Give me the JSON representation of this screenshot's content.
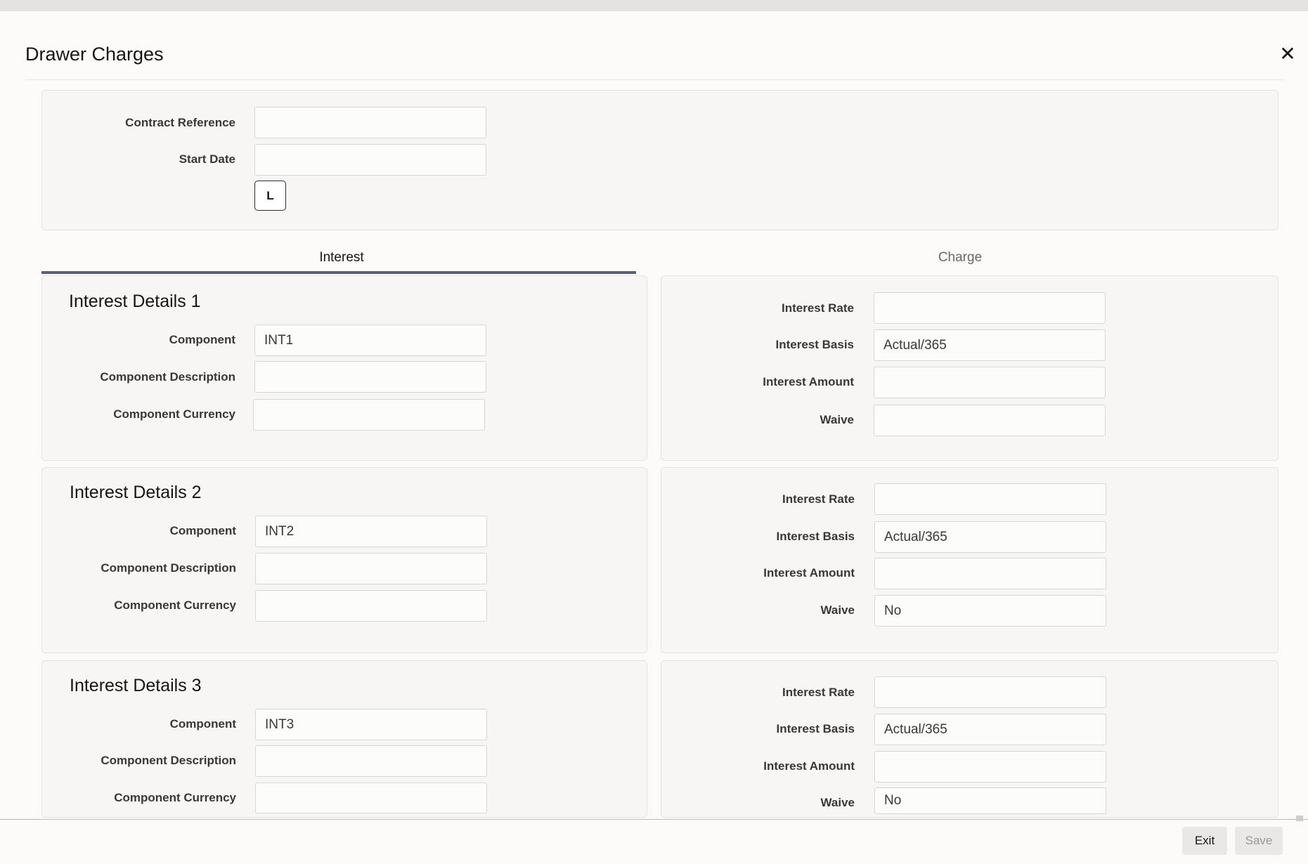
{
  "window": {
    "title": "Drawer Charges"
  },
  "header": {
    "contract_reference_label": "Contract Reference",
    "contract_reference_value": "",
    "start_date_label": "Start Date",
    "start_date_value": "",
    "lookup_button_label": "L"
  },
  "tabs": [
    {
      "label": "Interest",
      "active": true
    },
    {
      "label": "Charge",
      "active": false
    }
  ],
  "interest_details": [
    {
      "title": "Interest Details 1",
      "component_label": "Component",
      "component_value": "INT1",
      "description_label": "Component Description",
      "description_value": "",
      "currency_label": "Component Currency",
      "currency_value": "",
      "rate_label": "Interest Rate",
      "rate_value": "",
      "basis_label": "Interest Basis",
      "basis_value": "Actual/365",
      "amount_label": "Interest Amount",
      "amount_value": "",
      "waive_label": "Waive",
      "waive_value": ""
    },
    {
      "title": "Interest Details 2",
      "component_label": "Component",
      "component_value": "INT2",
      "description_label": "Component Description",
      "description_value": "",
      "currency_label": "Component Currency",
      "currency_value": "",
      "rate_label": "Interest Rate",
      "rate_value": "",
      "basis_label": "Interest Basis",
      "basis_value": "Actual/365",
      "amount_label": "Interest Amount",
      "amount_value": "",
      "waive_label": "Waive",
      "waive_value": "No"
    },
    {
      "title": "Interest Details 3",
      "component_label": "Component",
      "component_value": "INT3",
      "description_label": "Component Description",
      "description_value": "",
      "currency_label": "Component Currency",
      "currency_value": "",
      "rate_label": "Interest Rate",
      "rate_value": "",
      "basis_label": "Interest Basis",
      "basis_value": "Actual/365",
      "amount_label": "Interest Amount",
      "amount_value": "",
      "waive_label": "Waive",
      "waive_value": "No"
    }
  ],
  "footer": {
    "exit_label": "Exit",
    "save_label": "Save"
  },
  "icons": {
    "close": "close-icon"
  },
  "colors": {
    "tab_underline": "#5a6172",
    "panel_bg": "#f7f6f5"
  }
}
